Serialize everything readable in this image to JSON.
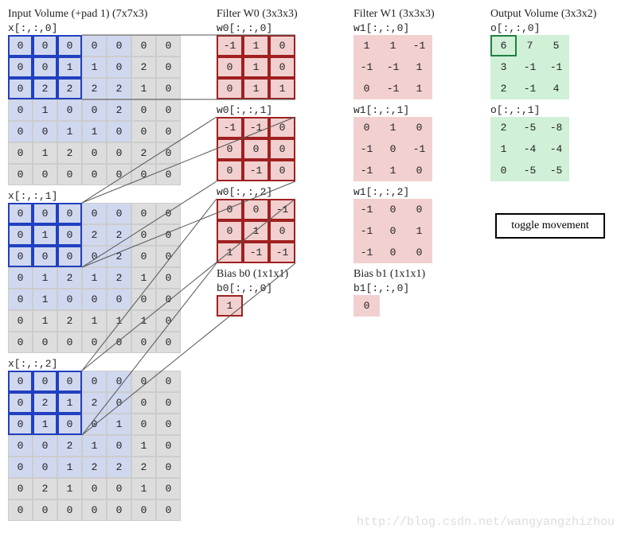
{
  "headings": {
    "input": "Input Volume (+pad 1) (7x7x3)",
    "w0": "Filter W0 (3x3x3)",
    "w1": "Filter W1 (3x3x3)",
    "out": "Output Volume (3x3x2)",
    "bias0": "Bias b0 (1x1x1)",
    "bias1": "Bias b1 (1x1x1)"
  },
  "slice_labels": {
    "x0": "x[:,:,0]",
    "x1": "x[:,:,1]",
    "x2": "x[:,:,2]",
    "w00": "w0[:,:,0]",
    "w01": "w0[:,:,1]",
    "w02": "w0[:,:,2]",
    "w10": "w1[:,:,0]",
    "w11": "w1[:,:,1]",
    "w12": "w1[:,:,2]",
    "o0": "o[:,:,0]",
    "o1": "o[:,:,1]",
    "b0": "b0[:,:,0]",
    "b1": "b1[:,:,0]"
  },
  "input": {
    "x0": [
      [
        0,
        0,
        0,
        0,
        0,
        0,
        0
      ],
      [
        0,
        0,
        1,
        1,
        0,
        2,
        0
      ],
      [
        0,
        2,
        2,
        2,
        2,
        1,
        0
      ],
      [
        0,
        1,
        0,
        0,
        2,
        0,
        0
      ],
      [
        0,
        0,
        1,
        1,
        0,
        0,
        0
      ],
      [
        0,
        1,
        2,
        0,
        0,
        2,
        0
      ],
      [
        0,
        0,
        0,
        0,
        0,
        0,
        0
      ]
    ],
    "x1": [
      [
        0,
        0,
        0,
        0,
        0,
        0,
        0
      ],
      [
        0,
        1,
        0,
        2,
        2,
        0,
        0
      ],
      [
        0,
        0,
        0,
        0,
        2,
        0,
        0
      ],
      [
        0,
        1,
        2,
        1,
        2,
        1,
        0
      ],
      [
        0,
        1,
        0,
        0,
        0,
        0,
        0
      ],
      [
        0,
        1,
        2,
        1,
        1,
        1,
        0
      ],
      [
        0,
        0,
        0,
        0,
        0,
        0,
        0
      ]
    ],
    "x2": [
      [
        0,
        0,
        0,
        0,
        0,
        0,
        0
      ],
      [
        0,
        2,
        1,
        2,
        0,
        0,
        0
      ],
      [
        0,
        1,
        0,
        0,
        1,
        0,
        0
      ],
      [
        0,
        0,
        2,
        1,
        0,
        1,
        0
      ],
      [
        0,
        0,
        1,
        2,
        2,
        2,
        0
      ],
      [
        0,
        2,
        1,
        0,
        0,
        1,
        0
      ],
      [
        0,
        0,
        0,
        0,
        0,
        0,
        0
      ]
    ]
  },
  "w0": {
    "s0": [
      [
        -1,
        1,
        0
      ],
      [
        0,
        1,
        0
      ],
      [
        0,
        1,
        1
      ]
    ],
    "s1": [
      [
        -1,
        -1,
        0
      ],
      [
        0,
        0,
        0
      ],
      [
        0,
        -1,
        0
      ]
    ],
    "s2": [
      [
        0,
        0,
        -1
      ],
      [
        0,
        1,
        0
      ],
      [
        1,
        -1,
        -1
      ]
    ]
  },
  "w1": {
    "s0": [
      [
        1,
        1,
        -1
      ],
      [
        -1,
        -1,
        1
      ],
      [
        0,
        -1,
        1
      ]
    ],
    "s1": [
      [
        0,
        1,
        0
      ],
      [
        -1,
        0,
        -1
      ],
      [
        -1,
        1,
        0
      ]
    ],
    "s2": [
      [
        -1,
        0,
        0
      ],
      [
        -1,
        0,
        1
      ],
      [
        -1,
        0,
        0
      ]
    ]
  },
  "out": {
    "o0": [
      [
        6,
        7,
        5
      ],
      [
        3,
        -1,
        -1
      ],
      [
        2,
        -1,
        4
      ]
    ],
    "o1": [
      [
        2,
        -5,
        -8
      ],
      [
        1,
        -4,
        -4
      ],
      [
        0,
        -5,
        -5
      ]
    ]
  },
  "bias": {
    "b0": 1,
    "b1": 0
  },
  "selected": {
    "rows": [
      0,
      1,
      2
    ],
    "cols": [
      0,
      1,
      2
    ],
    "out_row": 0,
    "out_col": 0
  },
  "toggle_label": "toggle movement",
  "watermark": "http://blog.csdn.net/wangyangzhizhou"
}
